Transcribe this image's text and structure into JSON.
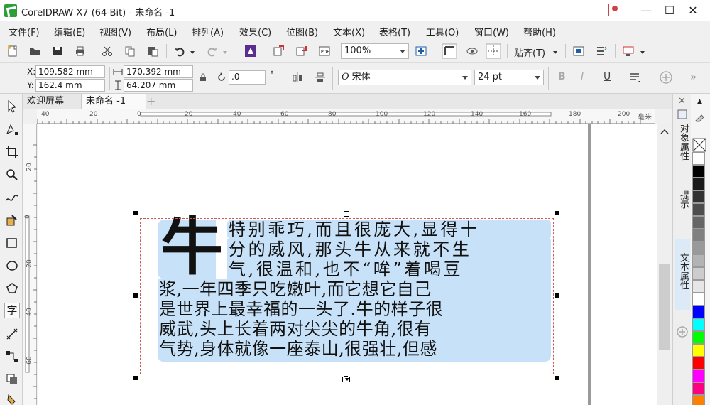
{
  "app": {
    "title": "CorelDRAW X7 (64-Bit) - 未命名 -1",
    "window_controls": {
      "minimize": "—",
      "maximize": "☐",
      "close": "✕"
    }
  },
  "menu": [
    "文件(F)",
    "编辑(E)",
    "视图(V)",
    "布局(L)",
    "排列(A)",
    "效果(C)",
    "位图(B)",
    "文本(X)",
    "表格(T)",
    "工具(O)",
    "窗口(W)",
    "帮助(H)"
  ],
  "toolbar": {
    "zoom": "100%",
    "snap_label": "贴齐(T)"
  },
  "properties": {
    "x": "109.582 mm",
    "y": "162.4 mm",
    "width": "170.392 mm",
    "height": "64.207 mm",
    "rotation": ".0",
    "degree": "°",
    "x_label": "X:",
    "y_label": "Y:",
    "font_name": "宋体",
    "font_size": "24 pt"
  },
  "tabs": [
    "欢迎屏幕",
    "未命名 -1"
  ],
  "ruler": {
    "unit": "毫米",
    "h_labels": [
      "40",
      "20",
      "0",
      "20",
      "40",
      "60",
      "80",
      "100",
      "120",
      "140",
      "160",
      "180",
      "200"
    ],
    "v_labels": [
      "20",
      "0",
      "20",
      "40",
      "60"
    ]
  },
  "dockers": [
    "对象属性",
    "提示",
    "文本属性"
  ],
  "text_frame": {
    "dropcap": "牛",
    "lines": [
      "特别乖巧,而且很庞大,显得十",
      "分的威风,那头牛从来就不生",
      "气,很温和,也不“哞”着喝豆",
      "浆,一年四季只吃嫩叶,而它想它自己",
      "是世界上最幸福的一头了.牛的样子很",
      "威武,头上长着两对尖尖的牛角,很有",
      "气势,身体就像一座泰山,很强壮,但感"
    ]
  },
  "colors": {
    "highlight": "#c7e2f8",
    "frame_border": "#c95a5a",
    "palette": [
      "#ffffff",
      "#000000",
      "#1a1a1a",
      "#333333",
      "#4d4d4d",
      "#666666",
      "#808080",
      "#999999",
      "#b3b3b3",
      "#cccccc",
      "#e6e6e6",
      "#ffffff",
      "#0000ff",
      "#00ffff",
      "#00ff00",
      "#ffff00",
      "#ff0000",
      "#ff00ff",
      "#ff0080",
      "#ff8000"
    ]
  }
}
